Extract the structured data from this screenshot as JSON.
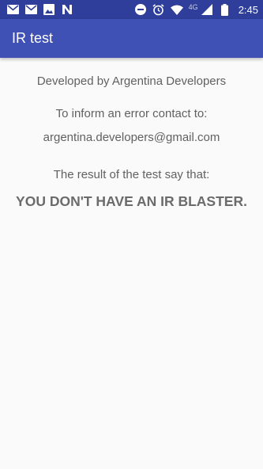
{
  "status_bar": {
    "left_icons": [
      "gmail-icon",
      "gmail-icon",
      "image-icon",
      "n-app-icon"
    ],
    "right_icons": [
      "do-not-disturb-icon",
      "alarm-icon",
      "wifi-icon",
      "cellular-signal-icon",
      "battery-icon"
    ],
    "network_type": "4G",
    "time": "2:45"
  },
  "app_bar": {
    "title": "IR test"
  },
  "content": {
    "developer_text": "Developed by Argentina Developers",
    "contact_intro": "To inform an error contact to:",
    "email": "argentina.developers@gmail.com",
    "result_intro": "The result of the test say that:",
    "result": "YOU DON'T HAVE AN IR BLASTER."
  },
  "colors": {
    "status_bar": "#2e3e9a",
    "app_bar": "#3f51b5",
    "background": "#fafafa",
    "text": "#616161"
  }
}
